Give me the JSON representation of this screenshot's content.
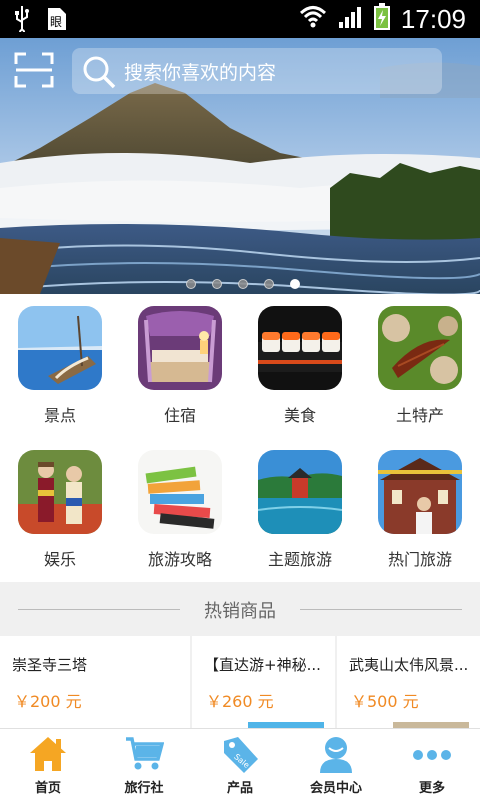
{
  "status_bar": {
    "time": "17:09",
    "icons": [
      "usb-icon",
      "debug-icon",
      "wifi-icon",
      "signal-icon",
      "battery-charging-icon"
    ]
  },
  "search": {
    "placeholder": "搜索你喜欢的内容",
    "scan_icon": "scan-icon",
    "search_icon": "search-icon"
  },
  "banner": {
    "slide_count": 5,
    "active_index": 4
  },
  "categories": [
    {
      "label": "景点",
      "icon": "scenic-spot-icon"
    },
    {
      "label": "住宿",
      "icon": "accommodation-icon"
    },
    {
      "label": "美食",
      "icon": "food-icon"
    },
    {
      "label": "土特产",
      "icon": "local-specialty-icon"
    },
    {
      "label": "娱乐",
      "icon": "entertainment-icon"
    },
    {
      "label": "旅游攻略",
      "icon": "travel-guide-icon"
    },
    {
      "label": "主题旅游",
      "icon": "theme-tour-icon"
    },
    {
      "label": "热门旅游",
      "icon": "popular-tour-icon"
    }
  ],
  "hot": {
    "title": "热销商品",
    "products": [
      {
        "name": "崇圣寺三塔",
        "price": "￥200 元"
      },
      {
        "name": "【直达游+神秘...",
        "price": "￥260 元"
      },
      {
        "name": "武夷山太伟风景...",
        "price": "￥500 元"
      }
    ]
  },
  "tabs": [
    {
      "label": "首页",
      "icon": "home-icon"
    },
    {
      "label": "旅行社",
      "icon": "cart-icon"
    },
    {
      "label": "产品",
      "icon": "sale-tag-icon"
    },
    {
      "label": "会员中心",
      "icon": "member-icon"
    },
    {
      "label": "更多",
      "icon": "more-icon"
    }
  ],
  "colors": {
    "accent": "#f08a24",
    "tab_icon": "#5bb4e8",
    "home_icon": "#f5a623"
  }
}
